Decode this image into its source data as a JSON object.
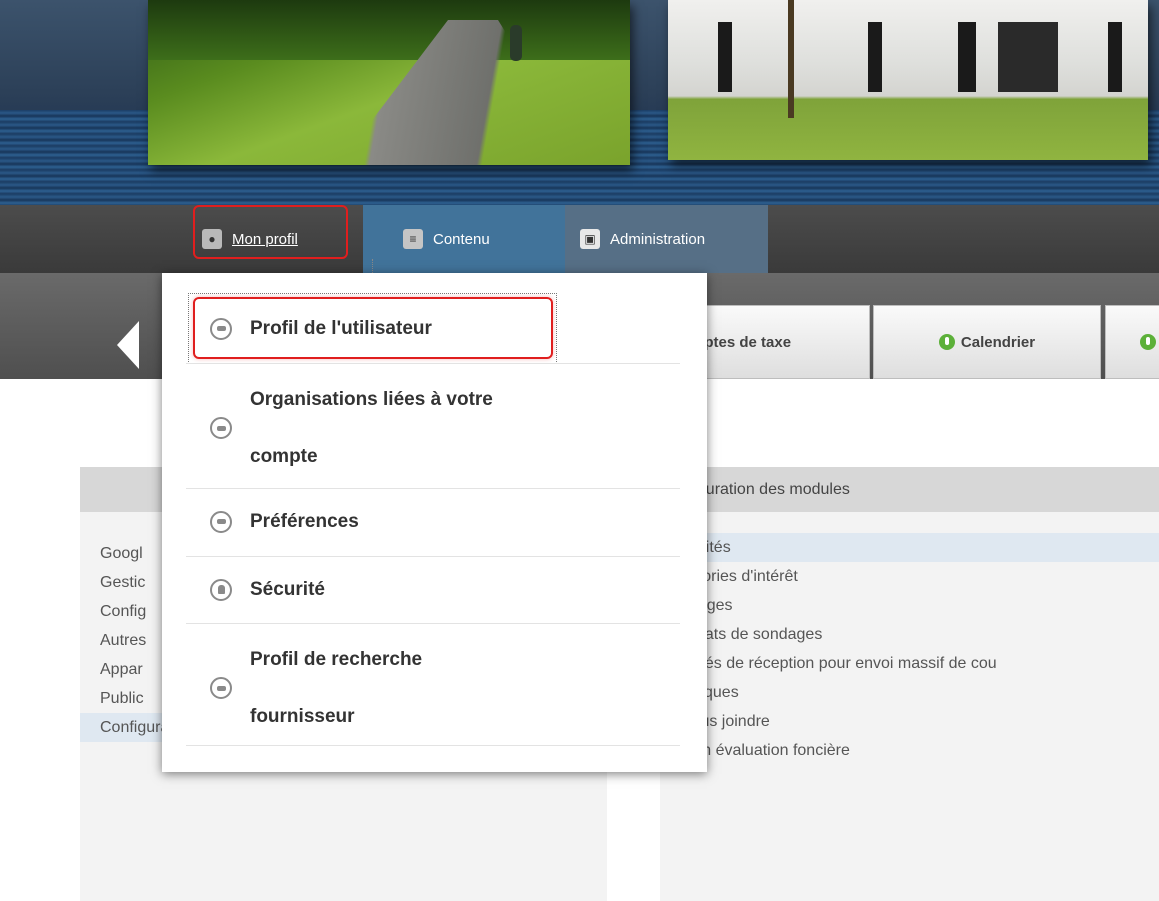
{
  "topnav": {
    "profil_label": "Mon profil",
    "contenu_label": "Contenu",
    "admin_label": "Administration"
  },
  "subtabs": {
    "comptes_label": "mptes de taxe",
    "calendrier_label": "Calendrier"
  },
  "left_list": {
    "items": [
      "Googl",
      "Gestic",
      "Config",
      "Autres",
      "Appar",
      "Public",
      "Configuration des modules"
    ],
    "selected_index": 6
  },
  "right_panel": {
    "header": "nfiguration des modules",
    "items": [
      "tualités",
      "tégories d'intérêt",
      "ndages",
      "sultats de sondages",
      "cusés de réception pour envoi massif de cou",
      "tistiques",
      "Nous joindre",
      "Mon évaluation foncière"
    ],
    "selected_index": 0
  },
  "dropdown": {
    "items": [
      {
        "label_lines": [
          "Profil de l'utilisateur"
        ],
        "icon": "circle-dash-icon"
      },
      {
        "label_lines": [
          "Organisations liées à votre",
          "compte"
        ],
        "icon": "circle-dash-icon"
      },
      {
        "label_lines": [
          "Préférences"
        ],
        "icon": "circle-dash-icon"
      },
      {
        "label_lines": [
          "Sécurité"
        ],
        "icon": "lock-icon"
      },
      {
        "label_lines": [
          "Profil de recherche",
          "fournisseur"
        ],
        "icon": "circle-dash-icon"
      }
    ]
  },
  "colors": {
    "highlight_red": "#e01e1e",
    "contenu_tab": "#41739a",
    "admin_tab": "#566f86",
    "green_dot": "#5cb039"
  }
}
